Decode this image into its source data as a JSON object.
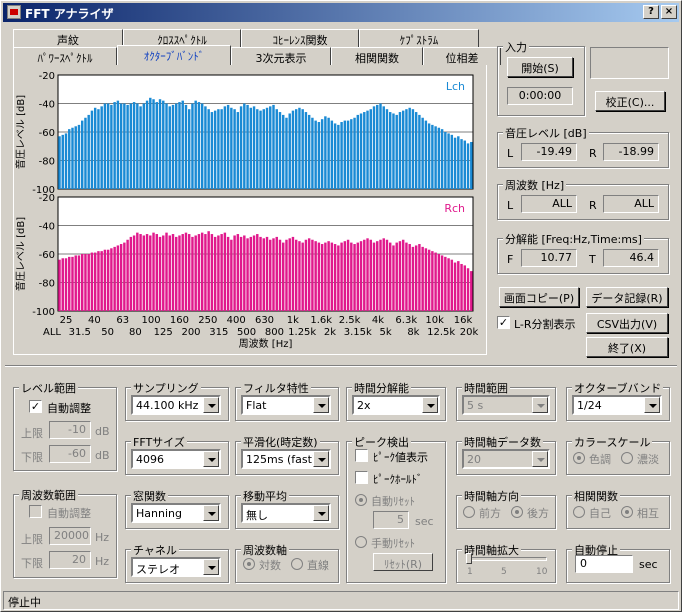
{
  "window": {
    "title": "FFT アナライザ",
    "help_label": "?",
    "close_label": "×"
  },
  "tabs_row1": [
    "声紋",
    "ｸﾛｽｽﾍﾟｸﾄﾙ",
    "ｺﾋｰﾚﾝｽ関数",
    "ｹﾌﾟｽﾄﾗﾑ"
  ],
  "tabs_row2": [
    "ﾊﾟﾜｰｽﾍﾟｸﾄﾙ",
    "ｵｸﾀｰﾌﾞﾊﾞﾝﾄﾞ",
    "3次元表示",
    "相関関数",
    "位相差"
  ],
  "active_tab": "ｵｸﾀｰﾌﾞﾊﾞﾝﾄﾞ",
  "chart_data": {
    "type": "bar",
    "ylabel": "音圧レベル [dB]",
    "xlabel": "周波数 [Hz]",
    "ylim": [
      -100,
      -20
    ],
    "yticks": [
      "-20",
      "-40",
      "-60",
      "-80",
      "-100"
    ],
    "xticks_top": [
      "25",
      "40",
      "63",
      "100",
      "160",
      "250",
      "400",
      "630",
      "1k",
      "1.6k",
      "2.5k",
      "4k",
      "6.3k",
      "10k",
      "16k"
    ],
    "xticks_bottom": [
      "ALL",
      "31.5",
      "50",
      "80",
      "125",
      "200",
      "315",
      "500",
      "800",
      "1.25k",
      "2k",
      "3.15k",
      "5k",
      "8k",
      "12.5k",
      "20k"
    ],
    "series": [
      {
        "name": "Lch",
        "color": "#1a8ad4",
        "values": [
          -63,
          -62,
          -61,
          -58,
          -57,
          -56,
          -55,
          -52,
          -50,
          -48,
          -45,
          -43,
          -44,
          -42,
          -40,
          -40,
          -41,
          -39,
          -38,
          -40,
          -40,
          -41,
          -40,
          -39,
          -40,
          -42,
          -40,
          -38,
          -36,
          -37,
          -39,
          -37,
          -38,
          -40,
          -42,
          -41,
          -40,
          -39,
          -38,
          -41,
          -44,
          -40,
          -38,
          -39,
          -40,
          -42,
          -44,
          -46,
          -45,
          -44,
          -44,
          -42,
          -41,
          -43,
          -44,
          -46,
          -42,
          -40,
          -41,
          -43,
          -42,
          -44,
          -45,
          -44,
          -43,
          -42,
          -41,
          -44,
          -46,
          -48,
          -50,
          -47,
          -45,
          -44,
          -43,
          -44,
          -46,
          -48,
          -50,
          -52,
          -53,
          -51,
          -49,
          -50,
          -52,
          -54,
          -55,
          -53,
          -52,
          -52,
          -51,
          -50,
          -48,
          -47,
          -46,
          -45,
          -44,
          -42,
          -41,
          -40,
          -42,
          -44,
          -46,
          -47,
          -48,
          -46,
          -45,
          -44,
          -43,
          -44,
          -46,
          -48,
          -50,
          -52,
          -54,
          -55,
          -56,
          -57,
          -58,
          -60,
          -61,
          -62,
          -64,
          -63,
          -65,
          -66,
          -68,
          -67
        ]
      },
      {
        "name": "Rch",
        "color": "#e0198c",
        "values": [
          -64,
          -63,
          -63,
          -62,
          -62,
          -61,
          -61,
          -60,
          -60,
          -60,
          -59,
          -59,
          -58,
          -58,
          -57,
          -57,
          -56,
          -55,
          -54,
          -53,
          -52,
          -50,
          -48,
          -47,
          -45,
          -46,
          -47,
          -46,
          -47,
          -45,
          -46,
          -48,
          -47,
          -45,
          -47,
          -46,
          -48,
          -47,
          -46,
          -45,
          -46,
          -48,
          -47,
          -46,
          -45,
          -46,
          -44,
          -46,
          -48,
          -47,
          -46,
          -45,
          -48,
          -50,
          -47,
          -46,
          -48,
          -47,
          -49,
          -48,
          -47,
          -46,
          -48,
          -49,
          -48,
          -50,
          -49,
          -48,
          -50,
          -52,
          -50,
          -49,
          -48,
          -50,
          -51,
          -52,
          -50,
          -49,
          -50,
          -51,
          -52,
          -53,
          -52,
          -51,
          -52,
          -53,
          -54,
          -52,
          -51,
          -50,
          -52,
          -53,
          -52,
          -51,
          -50,
          -49,
          -50,
          -52,
          -51,
          -50,
          -49,
          -50,
          -52,
          -54,
          -52,
          -51,
          -50,
          -52,
          -53,
          -55,
          -54,
          -53,
          -55,
          -56,
          -57,
          -58,
          -59,
          -60,
          -61,
          -62,
          -63,
          -64,
          -66,
          -65,
          -67,
          -68,
          -70,
          -72
        ]
      }
    ]
  },
  "input": {
    "label": "入力",
    "start_button": "開始(S)",
    "time": "0:00:00",
    "calibrate_button": "校正(C)..."
  },
  "level": {
    "label": "音圧レベル [dB]",
    "l_label": "L",
    "l_value": "-19.49",
    "r_label": "R",
    "r_value": "-18.99"
  },
  "freq": {
    "label": "周波数 [Hz]",
    "l_label": "L",
    "l_value": "ALL",
    "r_label": "R",
    "r_value": "ALL"
  },
  "resolution": {
    "label": "分解能 [Freq:Hz,Time:ms]",
    "f_label": "F",
    "f_value": "10.77",
    "t_label": "T",
    "t_value": "46.4"
  },
  "buttons": {
    "copy": "画面コピー(P)",
    "record": "データ記録(R)",
    "lr_split": "L-R分割表示",
    "csv": "CSV出力(V)",
    "exit": "終了(X)"
  },
  "level_range": {
    "label": "レベル範囲",
    "auto": "自動調整",
    "upper_label": "上限",
    "upper_value": "-10",
    "lower_label": "下限",
    "lower_value": "-60",
    "unit": "dB"
  },
  "freq_range": {
    "label": "周波数範囲",
    "auto": "自動調整",
    "upper_label": "上限",
    "upper_value": "20000",
    "lower_label": "下限",
    "lower_value": "20",
    "unit": "Hz"
  },
  "sampling": {
    "label": "サンプリング",
    "value": "44.100 kHz"
  },
  "fft_size": {
    "label": "FFTサイズ",
    "value": "4096"
  },
  "window_fn": {
    "label": "窓関数",
    "value": "Hanning"
  },
  "channel": {
    "label": "チャネル",
    "value": "ステレオ"
  },
  "filter": {
    "label": "フィルタ特性",
    "value": "Flat"
  },
  "smoothing": {
    "label": "平滑化(時定数)",
    "value": "125ms (fast)"
  },
  "moving_avg": {
    "label": "移動平均",
    "value": "無し"
  },
  "freq_axis": {
    "label": "周波数軸",
    "log": "対数",
    "linear": "直線"
  },
  "time_res": {
    "label": "時間分解能",
    "value": "2x"
  },
  "peak": {
    "label": "ピーク検出",
    "show": "ﾋﾟｰｸ値表示",
    "hold": "ﾋﾟｰｸﾎｰﾙﾄﾞ",
    "auto_reset": "自動ﾘｾｯﾄ",
    "auto_value": "5",
    "sec": "sec",
    "manual_reset": "手動ﾘｾｯﾄ",
    "reset_button": "ﾘｾｯﾄ(R)"
  },
  "time_range": {
    "label": "時間範囲",
    "value": "5 s"
  },
  "time_data": {
    "label": "時間軸データ数",
    "value": "20"
  },
  "time_dir": {
    "label": "時間軸方向",
    "front": "前方",
    "back": "後方"
  },
  "time_zoom": {
    "label": "時間軸拡大",
    "ticks": [
      "1",
      "5",
      "10"
    ]
  },
  "octave": {
    "label": "オクターブバンド",
    "value": "1/24"
  },
  "color_scale": {
    "label": "カラースケール",
    "color": "色調",
    "shade": "濃淡"
  },
  "correlation": {
    "label": "相関関数",
    "self": "自己",
    "mutual": "相互"
  },
  "auto_stop": {
    "label": "自動停止",
    "value": "0",
    "sec": "sec"
  },
  "status": "停止中"
}
